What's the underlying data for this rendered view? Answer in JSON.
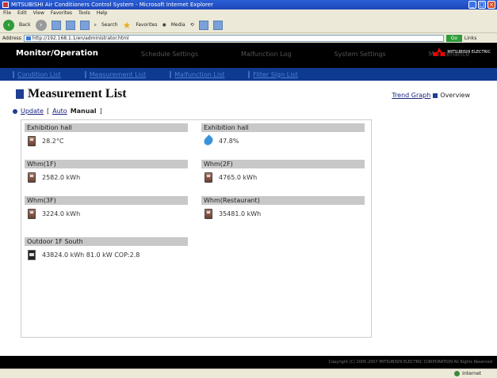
{
  "window": {
    "title": "MITSUBISHI Air Conditioners Control System - Microsoft Internet Explorer",
    "menu": [
      "File",
      "Edit",
      "View",
      "Favorites",
      "Tools",
      "Help"
    ],
    "toolbar": {
      "back_label": "Back",
      "search_label": "Search",
      "favorites_label": "Favorites",
      "media_label": "Media"
    },
    "address_label": "Address",
    "address_value": "http://192.168.1.1/en/administrator.html",
    "go_label": "Go",
    "links_label": "Links",
    "status_zone": "Internet"
  },
  "app_nav": {
    "items": [
      "Monitor/Operation",
      "Schedule Settings",
      "Malfunction Log",
      "System Settings",
      "Maintenance"
    ],
    "logo_text": "MITSUBISHI ELECTRIC"
  },
  "subnav": [
    "Condition List",
    "Measurement List",
    "Malfunction List",
    "Filter Sign List"
  ],
  "page": {
    "title": "Measurement List",
    "trend_graph_label": "Trend Graph",
    "overview_label": "Overview",
    "update_label": "Update",
    "mode_open": "[",
    "auto_label": "Auto",
    "manual_label": "Manual",
    "mode_close": "]"
  },
  "measurements": [
    {
      "name": "Exhibition hall",
      "value": "28.2°C",
      "icon": "thermometer-icon"
    },
    {
      "name": "Exhibition hall",
      "value": "47.8%",
      "icon": "humidity-icon"
    },
    {
      "name": "Whm(1F)",
      "value": "2582.0 kWh",
      "icon": "watt-hour-meter-icon"
    },
    {
      "name": "Whm(2F)",
      "value": "4765.0 kWh",
      "icon": "watt-hour-meter-icon"
    },
    {
      "name": "Whm(3F)",
      "value": "3224.0 kWh",
      "icon": "watt-hour-meter-icon"
    },
    {
      "name": "Whm(Restaurant)",
      "value": "35481.0 kWh",
      "icon": "watt-hour-meter-icon"
    },
    {
      "name": "Outdoor 1F South",
      "value": "43824.0 kWh   81.0 kW   COP:2.8",
      "icon": "outdoor-unit-icon"
    }
  ],
  "footer": "Copyright (C) 2005-2007 MITSUBISHI ELECTRIC CORPORATION All Rights Reserved",
  "colors": {
    "header_bg": "#000000",
    "subnav_bg": "#0e3b8f",
    "accent": "#1f3f92",
    "item_header_bg": "#c8c8c8"
  }
}
